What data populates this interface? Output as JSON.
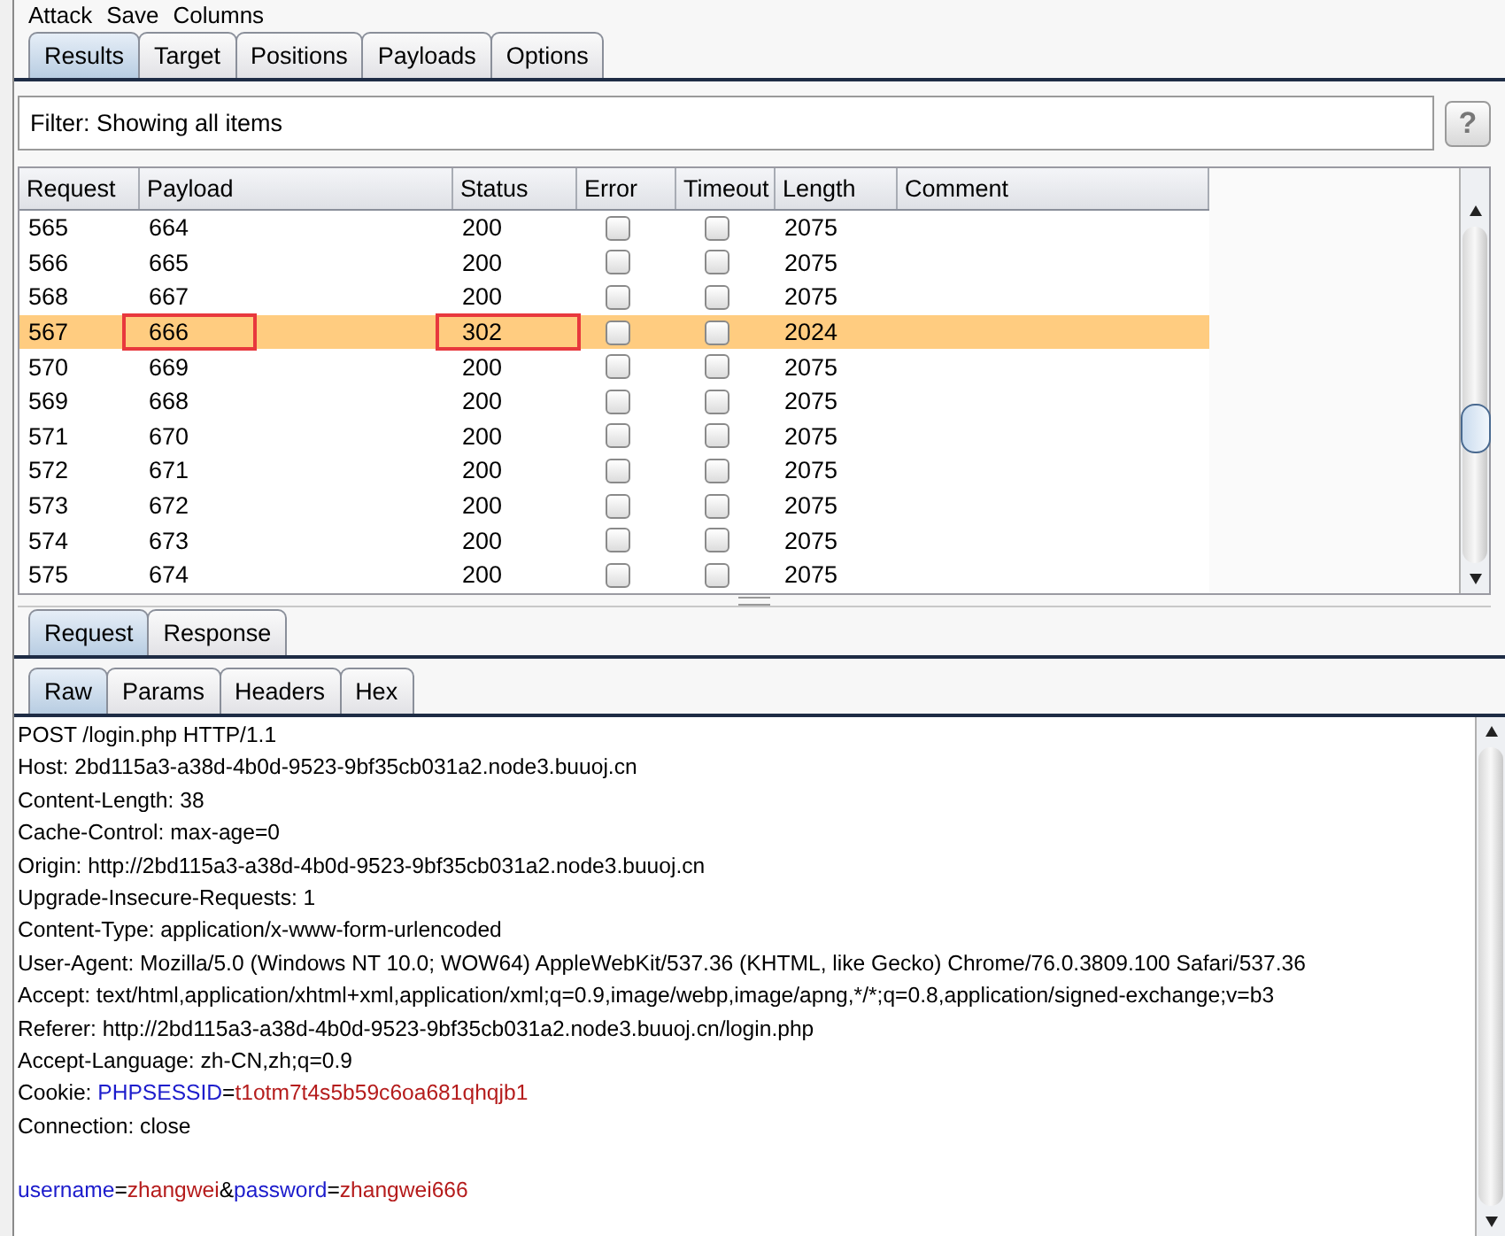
{
  "menu": [
    "Attack",
    "Save",
    "Columns"
  ],
  "tabs": [
    {
      "label": "Results",
      "selected": true
    },
    {
      "label": "Target",
      "selected": false
    },
    {
      "label": "Positions",
      "selected": false
    },
    {
      "label": "Payloads",
      "selected": false
    },
    {
      "label": "Options",
      "selected": false
    }
  ],
  "filter": {
    "text": "Filter: Showing all items",
    "help": "?"
  },
  "table": {
    "columns": [
      "Request",
      "Payload",
      "Status",
      "Error",
      "Timeout",
      "Length",
      "Comment"
    ],
    "rows": [
      {
        "request": "565",
        "payload": "664",
        "status": "200",
        "error": false,
        "timeout": false,
        "length": "2075",
        "selected": false,
        "marked": false
      },
      {
        "request": "566",
        "payload": "665",
        "status": "200",
        "error": false,
        "timeout": false,
        "length": "2075",
        "selected": false,
        "marked": false
      },
      {
        "request": "568",
        "payload": "667",
        "status": "200",
        "error": false,
        "timeout": false,
        "length": "2075",
        "selected": false,
        "marked": false
      },
      {
        "request": "567",
        "payload": "666",
        "status": "302",
        "error": false,
        "timeout": false,
        "length": "2024",
        "selected": true,
        "marked": true
      },
      {
        "request": "570",
        "payload": "669",
        "status": "200",
        "error": false,
        "timeout": false,
        "length": "2075",
        "selected": false,
        "marked": false
      },
      {
        "request": "569",
        "payload": "668",
        "status": "200",
        "error": false,
        "timeout": false,
        "length": "2075",
        "selected": false,
        "marked": false
      },
      {
        "request": "571",
        "payload": "670",
        "status": "200",
        "error": false,
        "timeout": false,
        "length": "2075",
        "selected": false,
        "marked": false
      },
      {
        "request": "572",
        "payload": "671",
        "status": "200",
        "error": false,
        "timeout": false,
        "length": "2075",
        "selected": false,
        "marked": false
      },
      {
        "request": "573",
        "payload": "672",
        "status": "200",
        "error": false,
        "timeout": false,
        "length": "2075",
        "selected": false,
        "marked": false
      },
      {
        "request": "574",
        "payload": "673",
        "status": "200",
        "error": false,
        "timeout": false,
        "length": "2075",
        "selected": false,
        "marked": false
      },
      {
        "request": "575",
        "payload": "674",
        "status": "200",
        "error": false,
        "timeout": false,
        "length": "2075",
        "selected": false,
        "marked": false
      }
    ]
  },
  "message_tabs": [
    {
      "label": "Request",
      "selected": true
    },
    {
      "label": "Response",
      "selected": false
    }
  ],
  "view_tabs": [
    {
      "label": "Raw",
      "selected": true
    },
    {
      "label": "Params",
      "selected": false
    },
    {
      "label": "Headers",
      "selected": false
    },
    {
      "label": "Hex",
      "selected": false
    }
  ],
  "request_lines": [
    [
      {
        "kind": "plain",
        "text": "POST /login.php HTTP/1.1"
      }
    ],
    [
      {
        "kind": "plain",
        "text": "Host: 2bd115a3-a38d-4b0d-9523-9bf35cb031a2.node3.buuoj.cn"
      }
    ],
    [
      {
        "kind": "plain",
        "text": "Content-Length: 38"
      }
    ],
    [
      {
        "kind": "plain",
        "text": "Cache-Control: max-age=0"
      }
    ],
    [
      {
        "kind": "plain",
        "text": "Origin: http://2bd115a3-a38d-4b0d-9523-9bf35cb031a2.node3.buuoj.cn"
      }
    ],
    [
      {
        "kind": "plain",
        "text": "Upgrade-Insecure-Requests: 1"
      }
    ],
    [
      {
        "kind": "plain",
        "text": "Content-Type: application/x-www-form-urlencoded"
      }
    ],
    [
      {
        "kind": "plain",
        "text": "User-Agent: Mozilla/5.0 (Windows NT 10.0; WOW64) AppleWebKit/537.36 (KHTML, like Gecko) Chrome/76.0.3809.100 Safari/537.36"
      }
    ],
    [
      {
        "kind": "plain",
        "text": "Accept: text/html,application/xhtml+xml,application/xml;q=0.9,image/webp,image/apng,*/*;q=0.8,application/signed-exchange;v=b3"
      }
    ],
    [
      {
        "kind": "plain",
        "text": "Referer: http://2bd115a3-a38d-4b0d-9523-9bf35cb031a2.node3.buuoj.cn/login.php"
      }
    ],
    [
      {
        "kind": "plain",
        "text": "Accept-Language: zh-CN,zh;q=0.9"
      }
    ],
    [
      {
        "kind": "plain",
        "text": "Cookie: "
      },
      {
        "kind": "name",
        "text": "PHPSESSID"
      },
      {
        "kind": "plain",
        "text": "="
      },
      {
        "kind": "value",
        "text": "t1otm7t4s5b59c6oa681qhqjb1"
      }
    ],
    [
      {
        "kind": "plain",
        "text": "Connection: close"
      }
    ]
  ],
  "request_body": [
    {
      "kind": "name",
      "text": "username"
    },
    {
      "kind": "plain",
      "text": "="
    },
    {
      "kind": "value",
      "text": "zhangwei"
    },
    {
      "kind": "plain",
      "text": "&"
    },
    {
      "kind": "name",
      "text": "password"
    },
    {
      "kind": "plain",
      "text": "="
    },
    {
      "kind": "value",
      "text": "zhangwei666"
    }
  ]
}
